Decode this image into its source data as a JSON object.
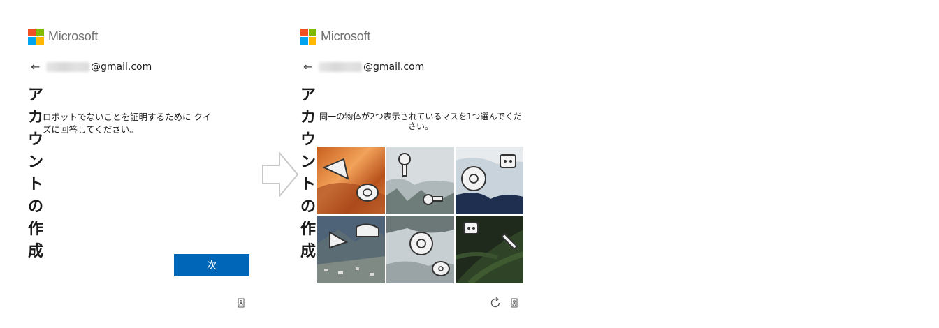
{
  "left": {
    "brand": {
      "name": "Microsoft",
      "colors": [
        "#f25022",
        "#7fba00",
        "#00a4ef",
        "#ffb900"
      ]
    },
    "account": {
      "back_icon": "back-arrow-icon",
      "email_suffix": "@gmail.com"
    },
    "title": "アカウントの作成",
    "description": "ロボットでないことを証明するために クイズに回答してください。",
    "next_label": "次",
    "audio_icon": "audio-icon"
  },
  "divider_arrow": {
    "icon": "right-arrow-icon"
  },
  "right": {
    "brand": {
      "name": "Microsoft"
    },
    "account": {
      "back_icon": "back-arrow-icon",
      "email_suffix": "@gmail.com"
    },
    "title": "アカウントの作成",
    "instruction": "同一の物体が2つ表示されているマスを1つ選んでください。",
    "tiles": [
      {
        "background": "canyon",
        "objects": [
          "fan-icon",
          "roll-icon"
        ]
      },
      {
        "background": "clouds",
        "objects": [
          "robot-icon",
          "robot-icon"
        ]
      },
      {
        "background": "sky",
        "objects": [
          "disc-icon",
          "robot-face-icon"
        ]
      },
      {
        "background": "mountain-town",
        "objects": [
          "fan-icon",
          "shoe-icon"
        ]
      },
      {
        "background": "clouds-water",
        "objects": [
          "disc-icon",
          "camera-icon"
        ]
      },
      {
        "background": "fern",
        "objects": [
          "robot-head-icon",
          "tube-icon"
        ]
      }
    ],
    "refresh_icon": "refresh-icon",
    "audio_icon": "audio-icon"
  },
  "accent_color": "#0067b8"
}
